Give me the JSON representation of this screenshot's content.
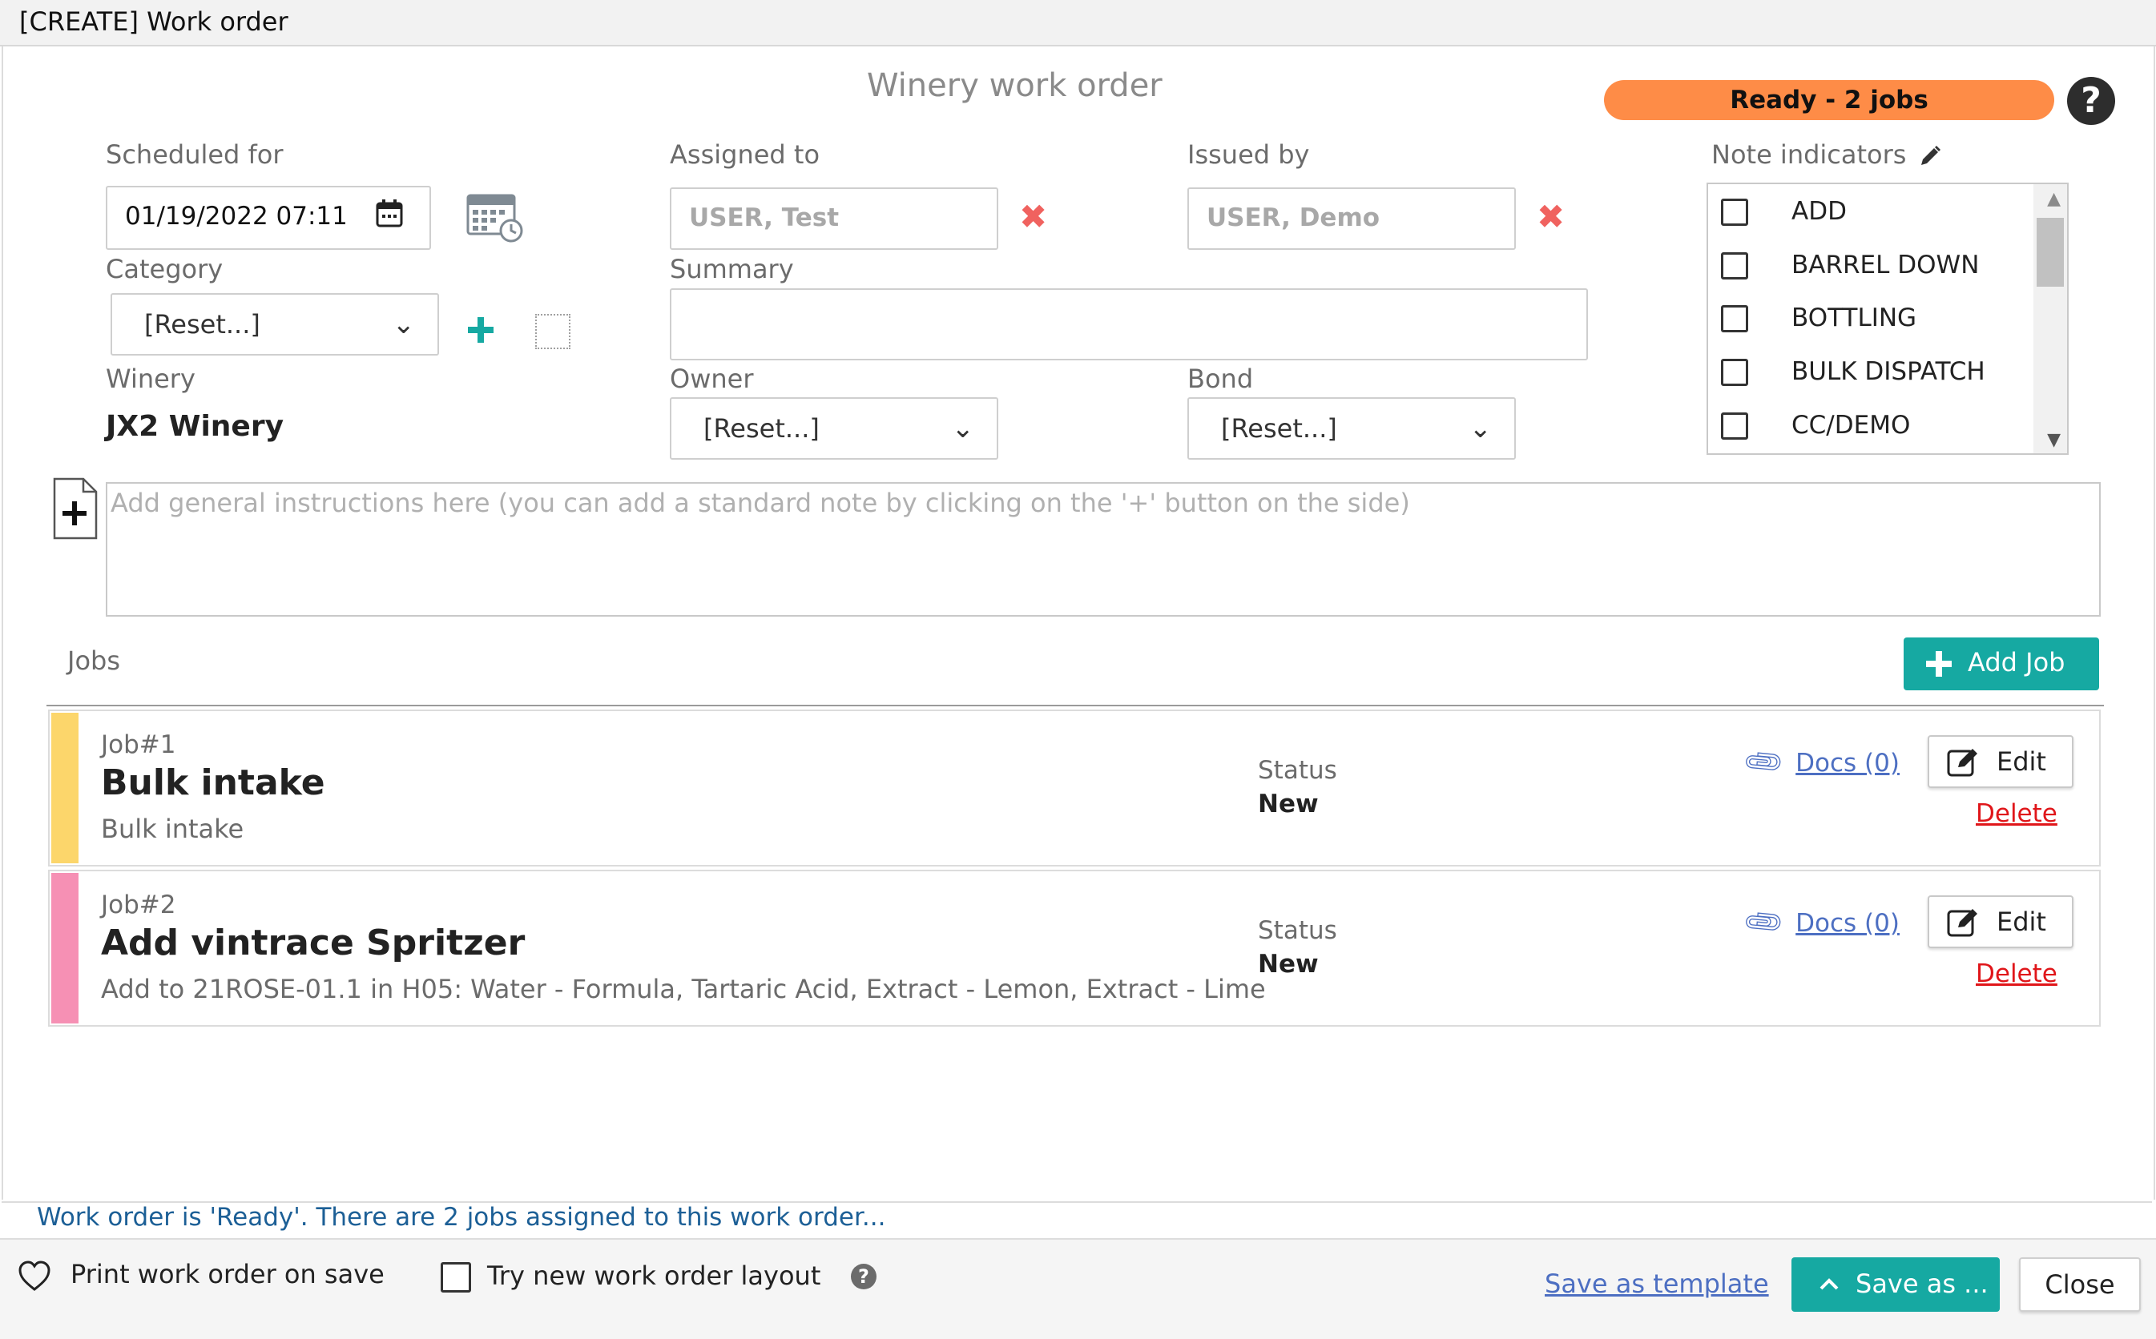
{
  "window": {
    "title": "[CREATE] Work order"
  },
  "form": {
    "heading": "Winery work order",
    "status_badge": "Ready - 2 jobs",
    "help_icon": "?",
    "scheduled_for": {
      "label": "Scheduled for",
      "value": "01/19/2022 07:11"
    },
    "assigned_to": {
      "label": "Assigned to",
      "value": "USER, Test"
    },
    "issued_by": {
      "label": "Issued by",
      "value": "USER, Demo"
    },
    "note_indicators": {
      "label": "Note indicators",
      "items": [
        "ADD",
        "BARREL DOWN",
        "BOTTLING",
        "BULK DISPATCH",
        "CC/DEMO"
      ]
    },
    "category": {
      "label": "Category",
      "value": "[Reset...]"
    },
    "summary": {
      "label": "Summary",
      "value": ""
    },
    "winery": {
      "label": "Winery",
      "value": "JX2 Winery"
    },
    "owner": {
      "label": "Owner",
      "value": "[Reset...]"
    },
    "bond": {
      "label": "Bond",
      "value": "[Reset...]"
    },
    "instructions": {
      "placeholder": "Add general instructions here (you can add a standard note by clicking on the '+' button on the side)"
    }
  },
  "jobs": {
    "label": "Jobs",
    "add_button": "Add Job",
    "items": [
      {
        "number": "Job#1",
        "title": "Bulk intake",
        "description": "Bulk intake",
        "status_label": "Status",
        "status": "New",
        "docs": "Docs (0)",
        "edit": "Edit",
        "delete": "Delete",
        "color": "#fcd66b"
      },
      {
        "number": "Job#2",
        "title": "Add vintrace Spritzer",
        "description": "Add to 21ROSE-01.1 in H05: Water - Formula, Tartaric Acid, Extract - Lemon, Extract - Lime",
        "status_label": "Status",
        "status": "New",
        "docs": "Docs (0)",
        "edit": "Edit",
        "delete": "Delete",
        "color": "#f690b4"
      }
    ]
  },
  "status_message": "Work order is 'Ready'. There are 2 jobs assigned to this work order...",
  "footer": {
    "print_on_save": "Print work order on save",
    "try_new_layout": "Try new work order layout",
    "save_template": "Save as template",
    "save_as": "Save as ...",
    "close": "Close"
  },
  "colors": {
    "accent": "#16a9a2",
    "badge": "#fe8c47",
    "clear_x": "#f0625f",
    "delete": "#e0161a",
    "link": "#4d6fc2",
    "status_text": "#1c5f96"
  }
}
